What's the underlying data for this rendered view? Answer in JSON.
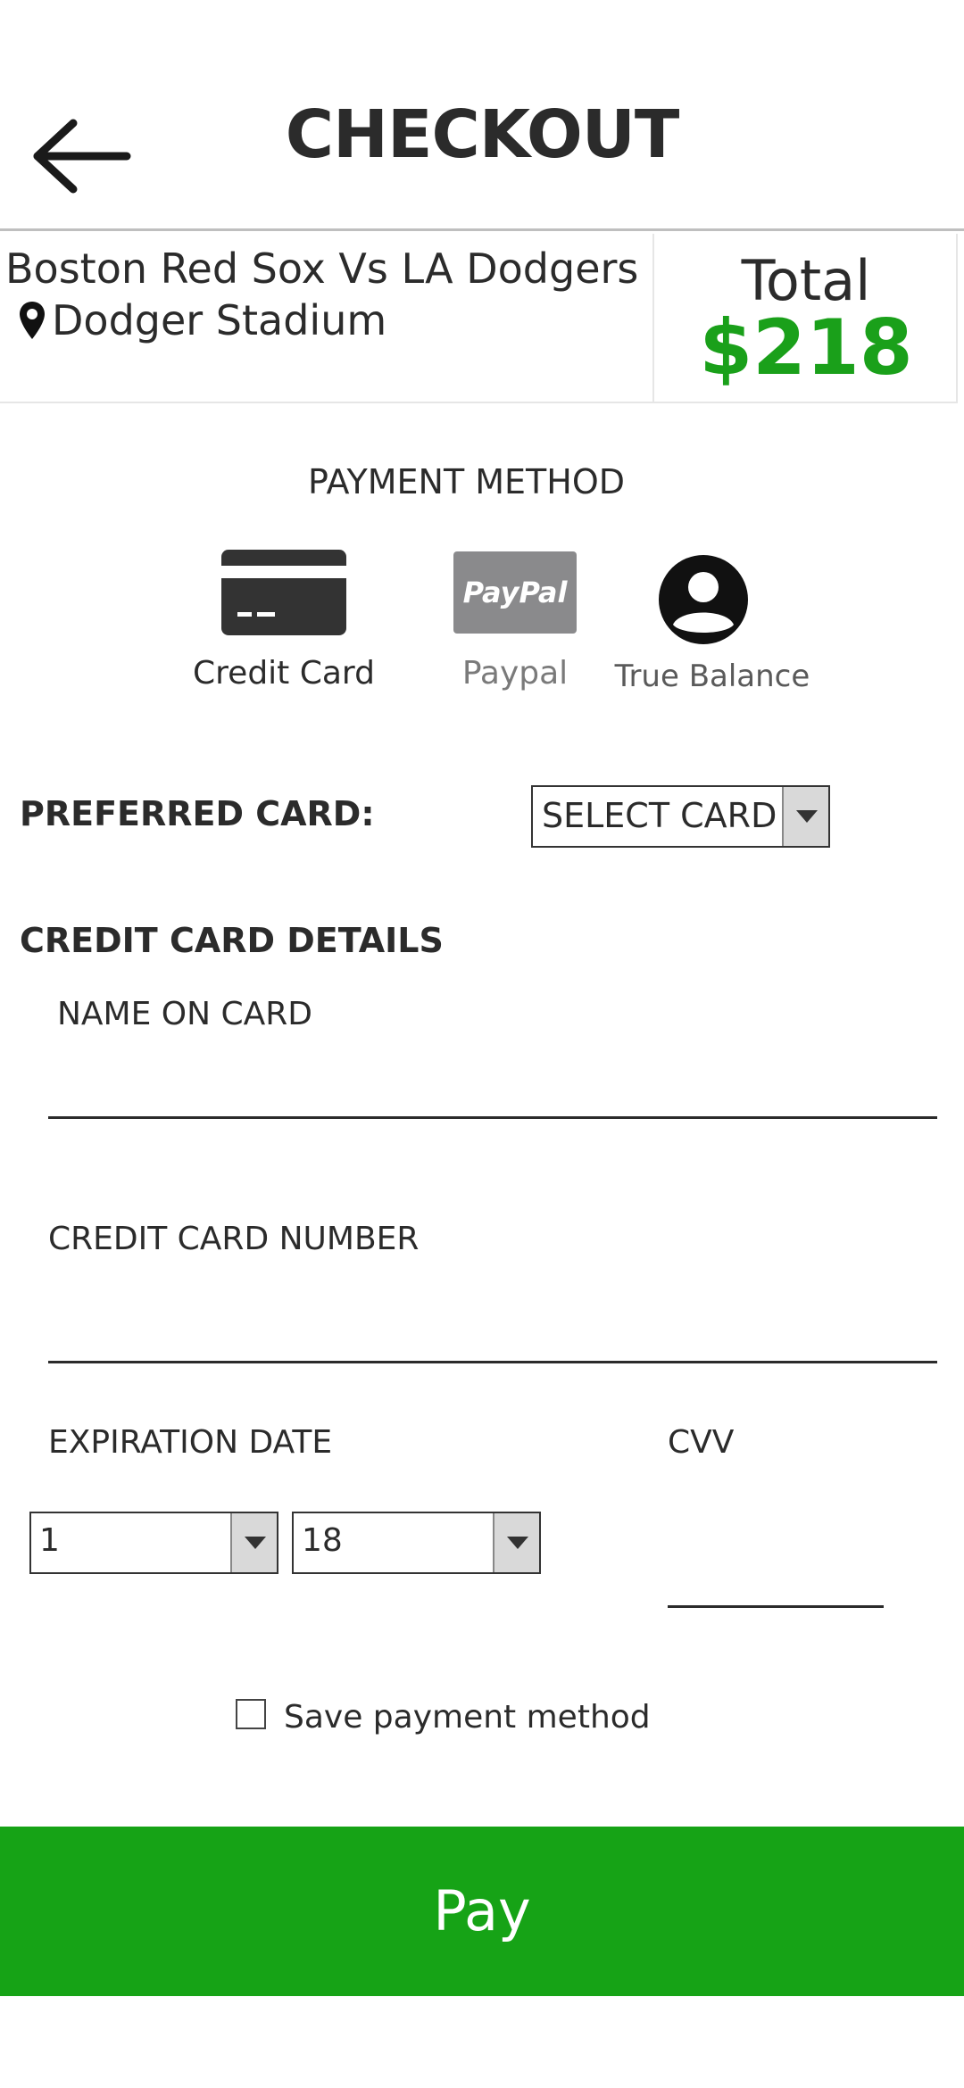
{
  "header": {
    "title": "CHECKOUT"
  },
  "event": {
    "title": "Boston Red Sox Vs LA Dodgers",
    "venue": "Dodger Stadium"
  },
  "total": {
    "label": "Total",
    "value": "$218"
  },
  "payment_method": {
    "title": "PAYMENT METHOD",
    "options": [
      {
        "label": "Credit Card",
        "icon": "credit-card-icon"
      },
      {
        "label": "Paypal",
        "icon": "paypal-logo-icon",
        "logo_text": "PayPal"
      },
      {
        "label": "True Balance",
        "icon": "account-circle-icon"
      }
    ]
  },
  "preferred_card": {
    "label": "PREFERRED CARD:",
    "selected": "SELECT CARD"
  },
  "card_details": {
    "title": "CREDIT CARD DETAILS",
    "name_label": "NAME ON CARD",
    "number_label": "CREDIT CARD NUMBER",
    "expiration_label": "EXPIRATION DATE",
    "month": "1",
    "year": "18",
    "cvv_label": "CVV"
  },
  "save": {
    "label": "Save payment method",
    "checked": false
  },
  "pay": {
    "label": "Pay"
  },
  "colors": {
    "accent_green": "#16a316",
    "total_green": "#1aa01a",
    "text": "#2b2b2b"
  }
}
